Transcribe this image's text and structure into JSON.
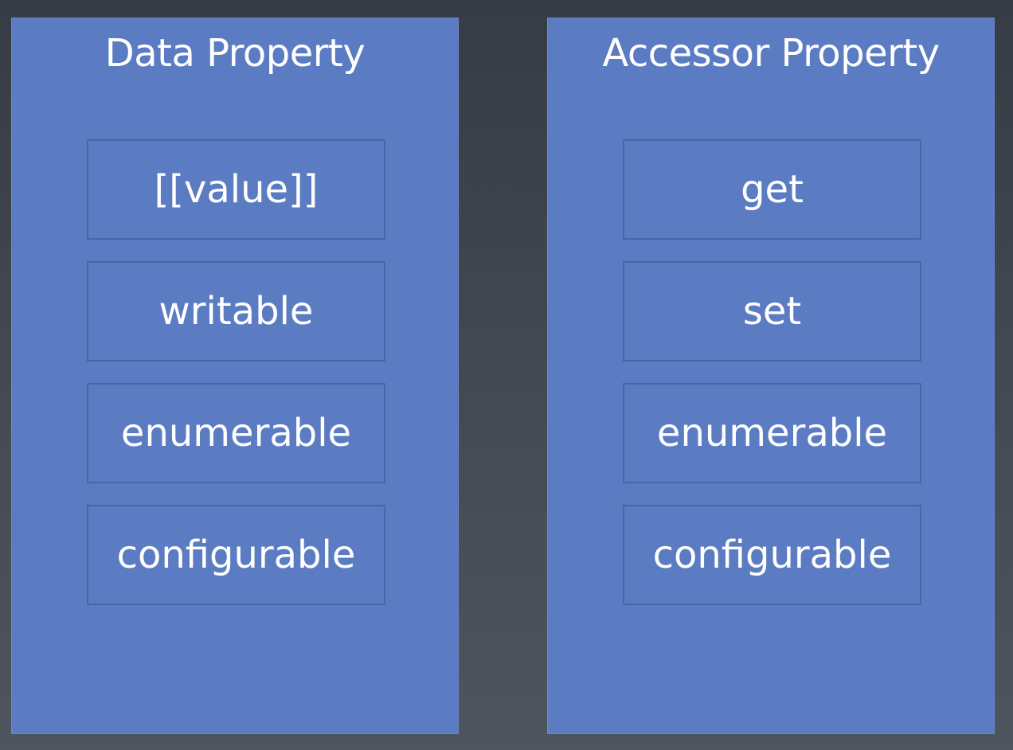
{
  "panels": [
    {
      "title": "Data Property",
      "attributes": [
        "[[value]]",
        "writable",
        "enumerable",
        "configurable"
      ]
    },
    {
      "title": "Accessor Property",
      "attributes": [
        "get",
        "set",
        "enumerable",
        "configurable"
      ]
    }
  ],
  "colors": {
    "panel_fill": "#5b7bc2",
    "box_border": "#4a64a6",
    "background": "#3d424b",
    "text": "#ffffff"
  }
}
